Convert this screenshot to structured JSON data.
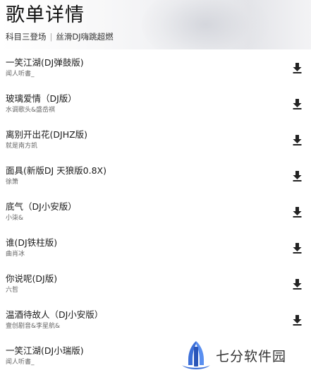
{
  "header": {
    "title": "歌单详情",
    "subtitle_left": "科目三登场",
    "subtitle_right": "丝滑DJ嗨跳超燃"
  },
  "songs": [
    {
      "title": "一笑江湖(DJ弹鼓版)",
      "artist": "闻人听書_"
    },
    {
      "title": "玻璃爱情（DJ版）",
      "artist": "水调歌头&盛岳褀"
    },
    {
      "title": "离别开出花(DJHZ版)",
      "artist": "就是南方凯"
    },
    {
      "title": "面具(新版DJ 天狼版0.8X)",
      "artist": "徐箫"
    },
    {
      "title": "底气（DJ小安版）",
      "artist": "小柒&"
    },
    {
      "title": "谁(DJ铁柱版)",
      "artist": "曲肖冰"
    },
    {
      "title": "你说呢(DJ版)",
      "artist": "六哲"
    },
    {
      "title": "温酒待故人（DJ小安版）",
      "artist": "壹创剧音&李星航&"
    },
    {
      "title": "一笑江湖(DJ小瑞版)",
      "artist": "闻人听書_"
    }
  ],
  "download_icon": "download-icon",
  "watermark": {
    "logo_icon": "qifen-logo",
    "text": "七分软件园"
  },
  "colors": {
    "text_primary": "#1a1a1a",
    "text_secondary": "#666666",
    "icon": "#222222",
    "logo_blue": "#3c6fd8"
  }
}
